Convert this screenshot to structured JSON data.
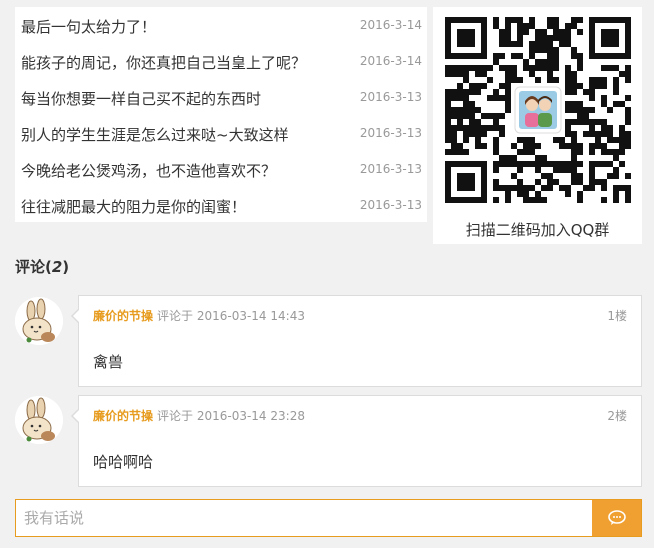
{
  "articles": [
    {
      "title": "最后一句太给力了！",
      "date": "2016-3-14"
    },
    {
      "title": "能孩子的周记，你还真把自己当皇上了呢？",
      "date": "2016-3-14"
    },
    {
      "title": "每当你想要一样自己买不起的东西时",
      "date": "2016-3-13"
    },
    {
      "title": "别人的学生生涯是怎么过来哒~大致这样",
      "date": "2016-3-13"
    },
    {
      "title": "今晚给老公煲鸡汤，也不造他喜欢不？",
      "date": "2016-3-13"
    },
    {
      "title": "往往减肥最大的阻力是你的闺蜜！",
      "date": "2016-3-13"
    }
  ],
  "qr": {
    "caption": "扫描二维码加入QQ群"
  },
  "comments_section": {
    "title_prefix": "评论(",
    "count": "2",
    "title_suffix": ")"
  },
  "comments": [
    {
      "author": "廉价的节操",
      "meta": "评论于 2016-03-14 14:43",
      "floor": "1楼",
      "text": "禽兽"
    },
    {
      "author": "廉价的节操",
      "meta": "评论于 2016-03-14 23:28",
      "floor": "2楼",
      "text": "哈哈啊哈"
    }
  ],
  "reply": {
    "placeholder": "我有话说"
  },
  "colors": {
    "accent": "#e79c1f",
    "send_button": "#f0a030",
    "background": "#f1f1f1"
  },
  "icons": {
    "send": "chat-bubble-icon",
    "avatar": "rabbit-avatar",
    "qr_center": "two-people-icon"
  }
}
